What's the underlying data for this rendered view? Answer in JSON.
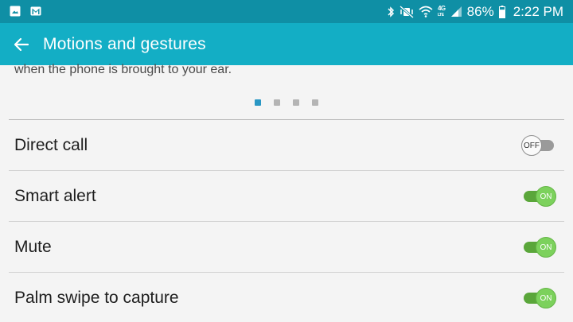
{
  "status_bar": {
    "left_icons": [
      "gallery-icon",
      "gmail-icon"
    ],
    "network": "4G",
    "network_sub": "LTE",
    "battery_percent": "86%",
    "battery_level": 0.86,
    "time": "2:22 PM"
  },
  "app_bar": {
    "title": "Motions and gestures",
    "back_icon": "arrow-left-icon",
    "color": "#13aec5"
  },
  "page": {
    "description_tail": "when the phone is brought to your ear.",
    "pager": {
      "count": 4,
      "active_index": 0
    }
  },
  "settings": [
    {
      "label": "Direct call",
      "state": "OFF"
    },
    {
      "label": "Smart alert",
      "state": "ON"
    },
    {
      "label": "Mute",
      "state": "ON"
    },
    {
      "label": "Palm swipe to capture",
      "state": "ON"
    }
  ],
  "colors": {
    "status_bar": "#0f8fa5",
    "toggle_on": "#7cd15c",
    "toggle_off": "#9a9a9a",
    "pager_active": "#2a97c4"
  }
}
